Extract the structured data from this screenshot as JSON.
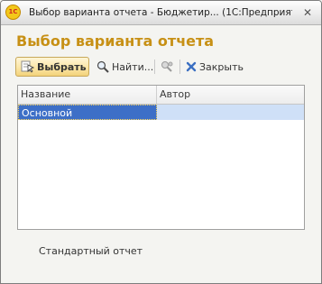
{
  "window": {
    "logo_text": "1С",
    "title": "Выбор варианта отчета - Бюджетир...   (1С:Предприятие)",
    "close_glyph": "✕"
  },
  "heading": "Выбор варианта отчета",
  "toolbar": {
    "select_label": "Выбрать",
    "find_label": "Найти...",
    "close_label": "Закрыть"
  },
  "list": {
    "columns": [
      "Название",
      "Автор"
    ],
    "rows": [
      {
        "name": "Основной",
        "author": ""
      }
    ]
  },
  "footer": "Стандартный отчет",
  "colors": {
    "heading": "#c79015",
    "selection": "#3d6fc7",
    "selection_light": "#cfe0f7",
    "primary_button": "#fbe6a8"
  },
  "icons": [
    "app-logo-icon",
    "select-icon",
    "find-icon",
    "copy-icon",
    "delete-icon",
    "close-icon"
  ]
}
